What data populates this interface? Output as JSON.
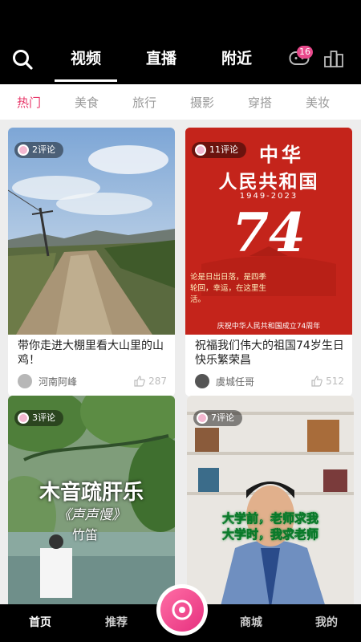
{
  "top_tabs": [
    "视频",
    "直播",
    "附近"
  ],
  "message_badge": "16",
  "categories": [
    "热门",
    "美食",
    "旅行",
    "摄影",
    "穿搭",
    "美妆"
  ],
  "cards": [
    {
      "comments": "2评论",
      "title": "带你走进大棚里看大山里的山鸡！",
      "author": "河南阿峰",
      "likes": "287"
    },
    {
      "comments": "11评论",
      "title": "祝福我们伟大的祖国74岁生日快乐繁荣昌",
      "author": "虞城任哥",
      "likes": "512",
      "poster": {
        "line1": "中华",
        "line2": "人民共和国",
        "years": "1949-2023",
        "number": "74",
        "slogan": "论是日出日落，是四季轮回，幸运，在这里生活。",
        "footer": "庆祝中华人民共和国成立74周年"
      }
    },
    {
      "comments": "3评论",
      "title": "",
      "author": "",
      "likes": "",
      "poster": {
        "line1": "木音疏肝乐",
        "line2": "《声声慢》",
        "line3": "竹笛"
      }
    },
    {
      "comments": "7评论",
      "title": "",
      "author": "",
      "likes": "",
      "poster": {
        "line1": "大学前，老师求我",
        "line2": "大学时，我求老师"
      }
    }
  ],
  "bottom_nav": [
    "首页",
    "推荐",
    "商城",
    "我的"
  ],
  "colors": {
    "accent": "#e8386a",
    "badge": "#e84a8c"
  }
}
